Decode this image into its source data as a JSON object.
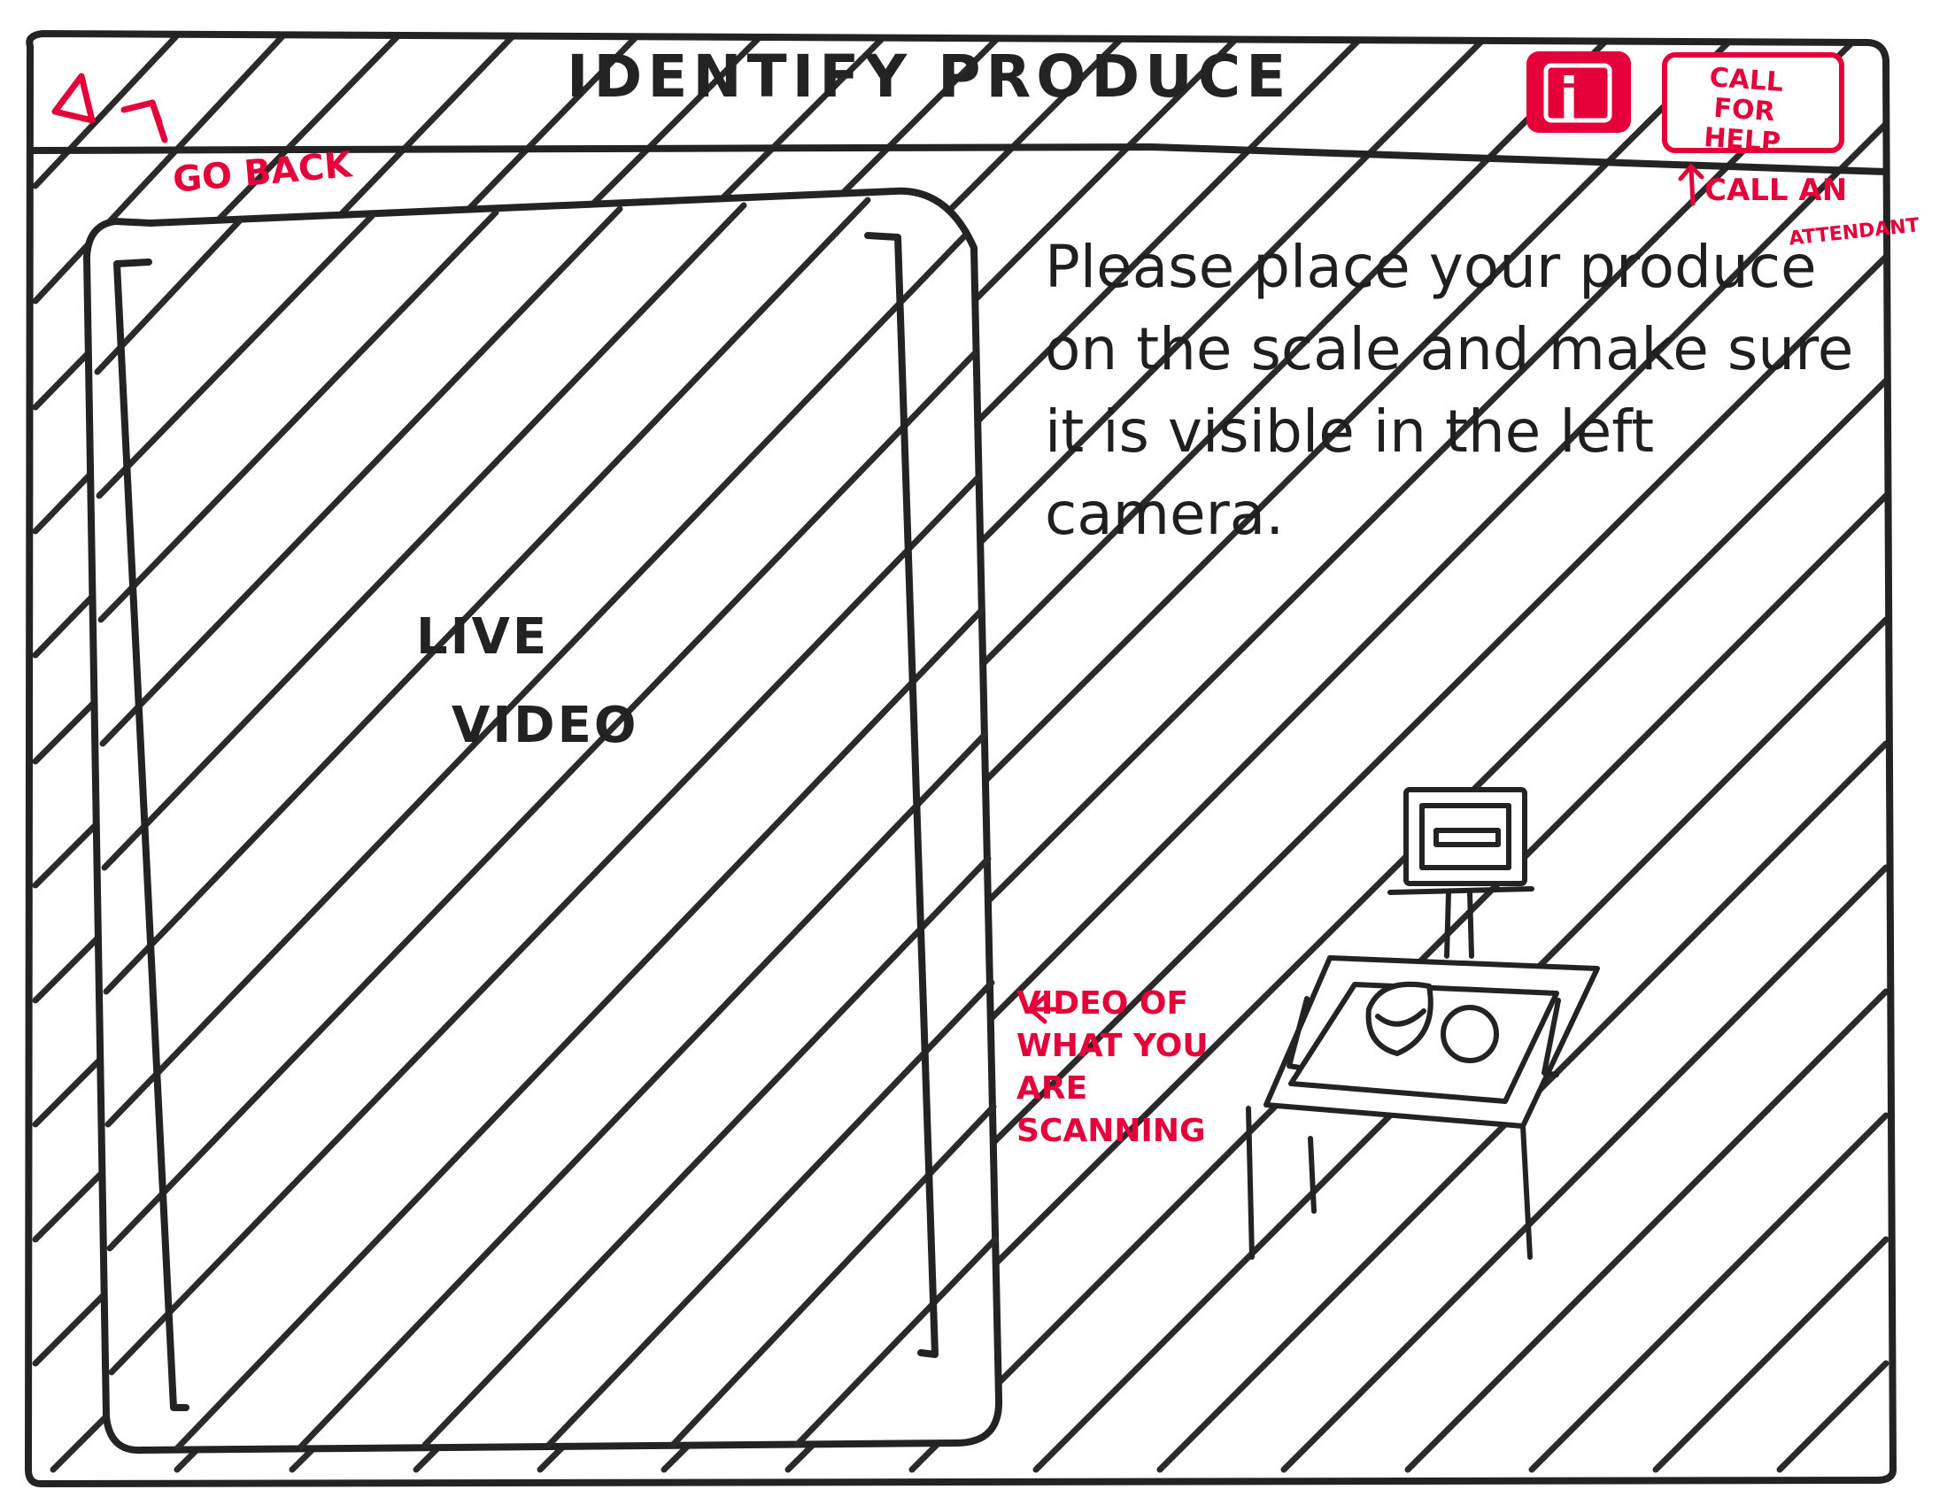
{
  "header": {
    "title": "IDENTIFY PRODUCE",
    "back_annotation": "GO BACK",
    "info_icon": "i",
    "help_button_label": "CALL FOR HELP",
    "help_annotation_line1": "CALL AN",
    "help_annotation_line2": "ATTENDANT"
  },
  "main": {
    "video_panel_label_line1": "LIVE",
    "video_panel_label_line2": "VIDEO",
    "instructions": "Please place your produce on the scale and make sure it is visible in the left camera.",
    "video_annotation": "VIDEO OF WHAT YOU ARE SCANNING"
  },
  "colors": {
    "ink": "#232323",
    "annotation_red": "#e5003a"
  }
}
